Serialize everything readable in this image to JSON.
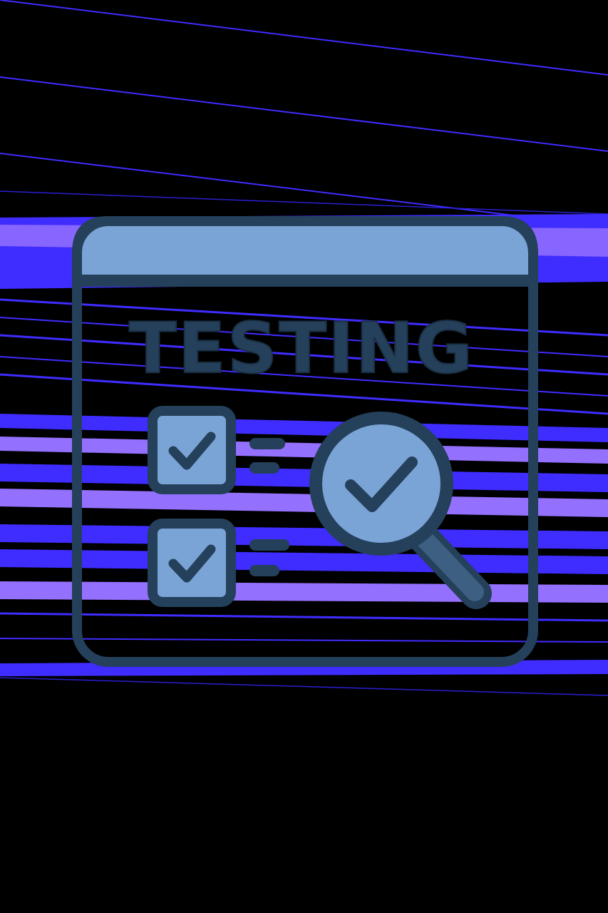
{
  "illustration": {
    "title": "TESTING",
    "icons": [
      "browser-window-icon",
      "checkbox-checked-icon",
      "magnifier-check-icon"
    ],
    "checklist": [
      {
        "checked": true
      },
      {
        "checked": true
      }
    ]
  },
  "colors": {
    "background": "#000000",
    "stripe_blue": "#3f2cff",
    "stripe_violet": "#9470ff",
    "icon_fill": "#7aa3d6",
    "icon_stroke": "#24405a",
    "handle_fill": "#3c5f82"
  }
}
